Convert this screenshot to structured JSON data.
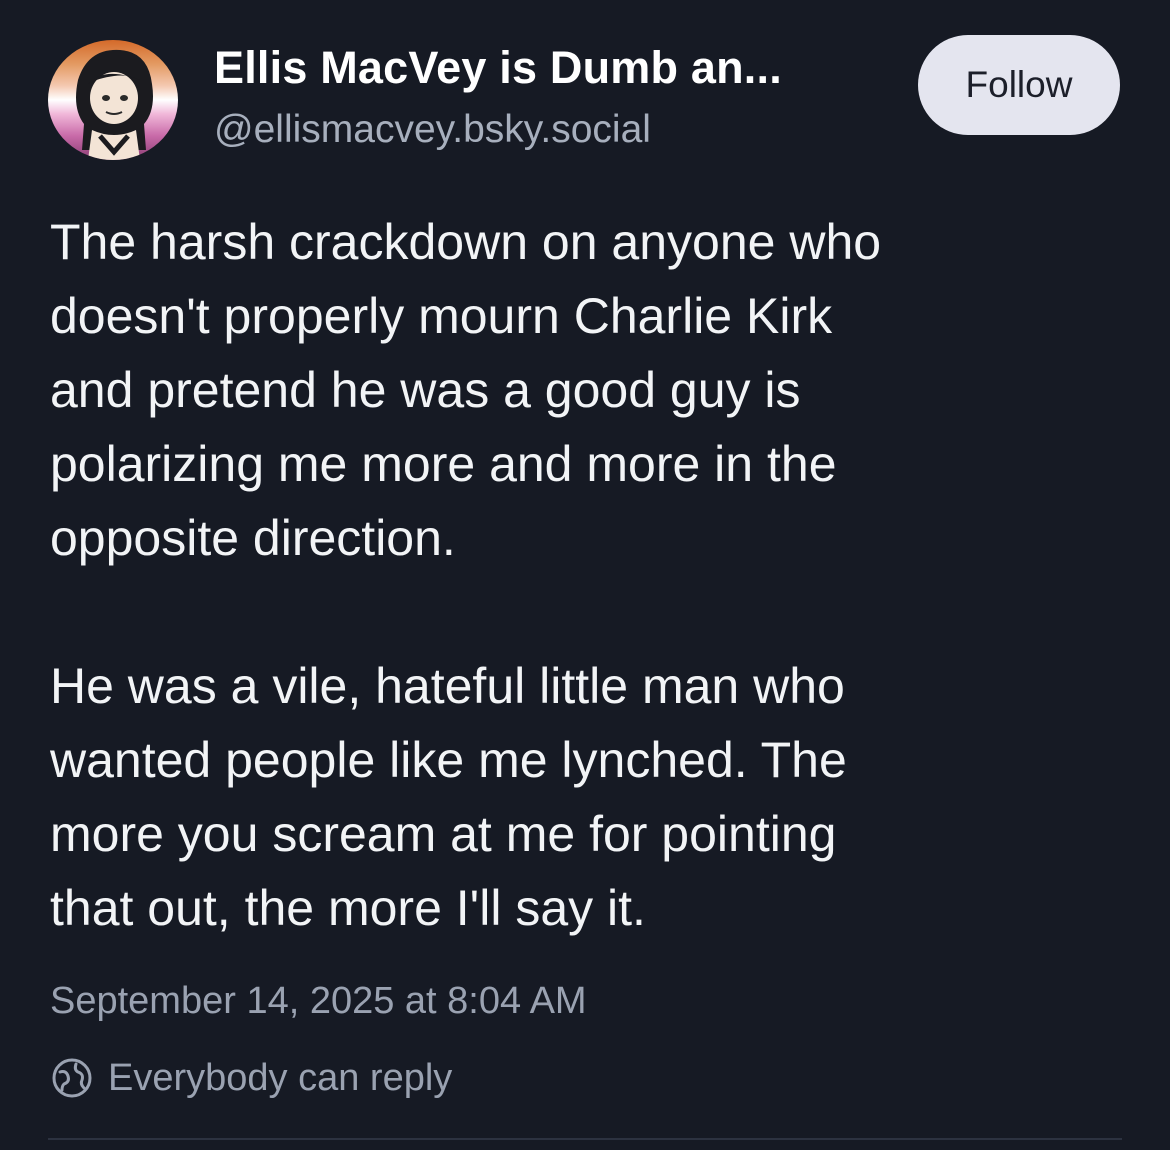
{
  "author": {
    "display_name": "Ellis MacVey is Dumb an...",
    "handle": "@ellismacvey.bsky.social",
    "avatar_icon": "avatar-illustration"
  },
  "follow_button": {
    "label": "Follow"
  },
  "post": {
    "paragraphs": [
      [
        "The harsh crackdown on anyone who",
        "doesn't properly mourn Charlie Kirk",
        "and pretend he was a good guy is",
        "polarizing me more and more in the",
        "opposite direction."
      ],
      [
        "He was a vile, hateful little man who",
        "wanted people like me lynched. The",
        "more you scream at me for pointing",
        "that out, the more I'll say it."
      ]
    ],
    "timestamp": "September 14, 2025 at 8:04 AM",
    "reply_setting": {
      "label": "Everybody can reply",
      "icon": "globe-icon"
    }
  },
  "colors": {
    "background": "#161a24",
    "text": "#f2f4f6",
    "muted": "#9aa2b1",
    "button_bg": "#e4e5ef"
  }
}
